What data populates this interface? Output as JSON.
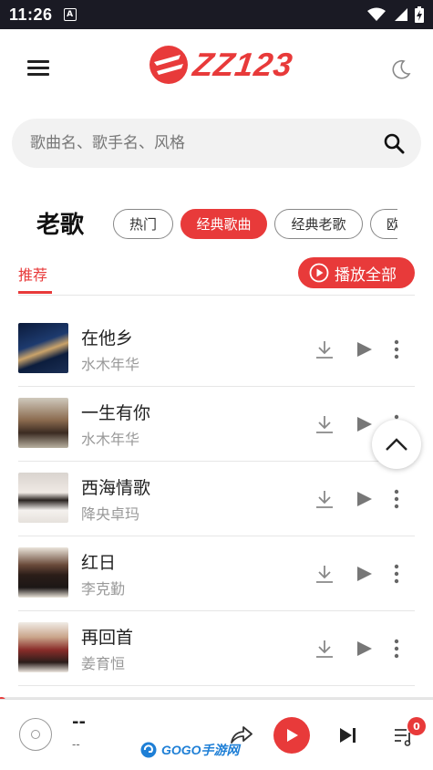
{
  "status_bar": {
    "time": "11:26",
    "notification_badge": "A"
  },
  "header": {
    "logo_text": "ZZ123",
    "brand_color": "#e83a3a"
  },
  "search": {
    "placeholder": "歌曲名、歌手名、风格"
  },
  "category": {
    "title": "老歌",
    "chips": [
      {
        "label": "热门",
        "active": false
      },
      {
        "label": "经典歌曲",
        "active": true
      },
      {
        "label": "经典老歌",
        "active": false
      },
      {
        "label": "欧",
        "active": false
      }
    ]
  },
  "tabs": {
    "recommend_label": "推荐",
    "play_all_label": "播放全部"
  },
  "songs": [
    {
      "title": "在他乡",
      "artist": "水木年华"
    },
    {
      "title": "一生有你",
      "artist": "水木年华"
    },
    {
      "title": "西海情歌",
      "artist": "降央卓玛"
    },
    {
      "title": "红日",
      "artist": "李克勤"
    },
    {
      "title": "再回首",
      "artist": "姜育恒"
    }
  ],
  "player": {
    "now_title": "--",
    "now_artist": "--",
    "progress": 0,
    "queue_count": "0"
  },
  "watermark": {
    "text": "GOGO手游网",
    "url": "www.gogo.cn"
  }
}
